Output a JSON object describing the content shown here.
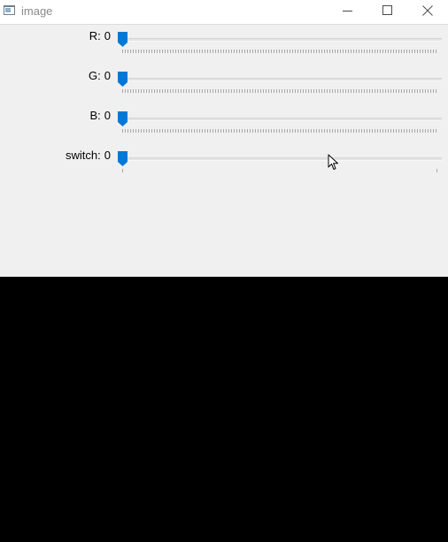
{
  "window": {
    "title": "image",
    "icon": "opencv-window-icon",
    "buttons": [
      "minimize-icon",
      "maximize-icon",
      "close-icon"
    ]
  },
  "trackbars": [
    {
      "label": "R:",
      "value": "0",
      "fill_fraction": 0,
      "ticks": "dense"
    },
    {
      "label": "G:",
      "value": "0",
      "fill_fraction": 0,
      "ticks": "dense"
    },
    {
      "label": "B:",
      "value": "0",
      "fill_fraction": 0,
      "ticks": "dense"
    },
    {
      "label": "switch:",
      "value": "0",
      "fill_fraction": 0,
      "ticks": "sparse"
    }
  ],
  "image": {
    "color": "#000000"
  },
  "colors": {
    "accent": "#0078d7",
    "panel": "#f0f0f0",
    "titlebar": "#ffffff"
  }
}
